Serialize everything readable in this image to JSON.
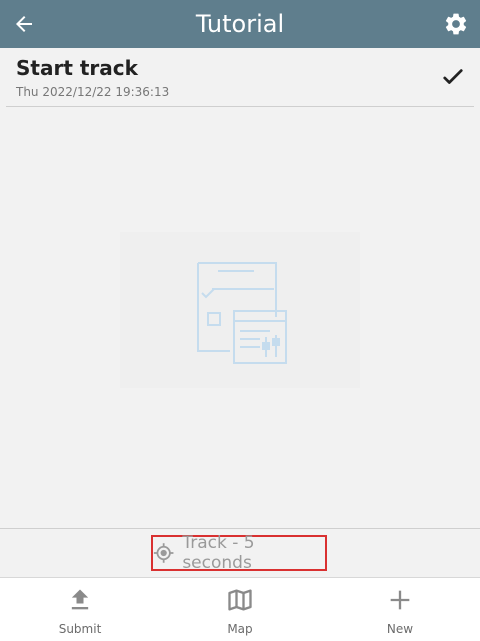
{
  "header": {
    "title": "Tutorial",
    "back_icon": "arrow-left-icon",
    "settings_icon": "gear-icon",
    "background": "#5f7e8d"
  },
  "list": {
    "items": [
      {
        "title": "Start track",
        "date": "Thu 2022/12/22 19:36:13",
        "status_icon": "checkmark-icon"
      }
    ]
  },
  "empty_state": {
    "icon": "form-checklist-icon"
  },
  "track": {
    "label": "Track - 5 seconds",
    "icon": "gps-target-icon",
    "highlight_color": "#d93030"
  },
  "tabs": [
    {
      "label": "Submit",
      "icon": "upload-icon"
    },
    {
      "label": "Map",
      "icon": "map-icon"
    },
    {
      "label": "New",
      "icon": "plus-icon"
    }
  ]
}
